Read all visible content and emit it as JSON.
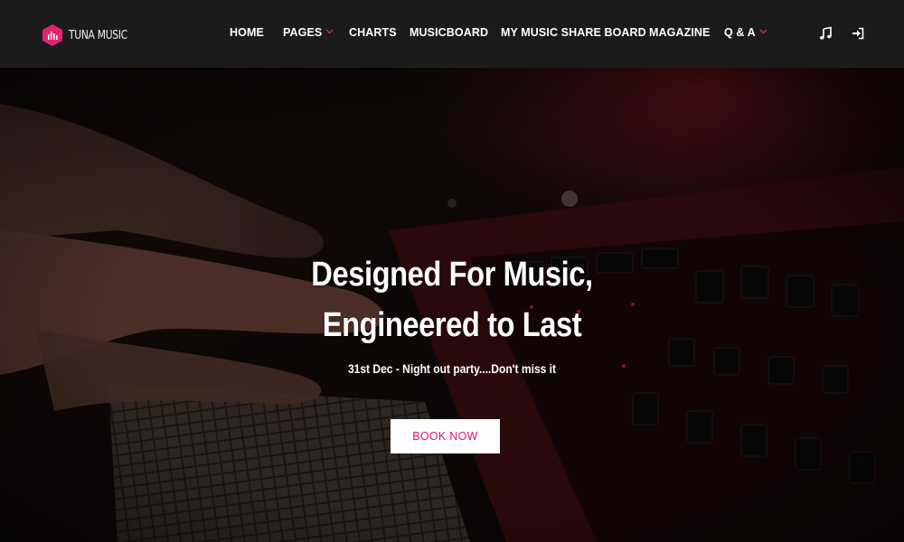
{
  "brand": {
    "name": "TUNA MUSIC",
    "accent": "#e5226f"
  },
  "nav": {
    "items": [
      {
        "label": "HOME",
        "dropdown": false
      },
      {
        "label": "PAGES",
        "dropdown": true
      },
      {
        "label": "CHARTS",
        "dropdown": false
      },
      {
        "label": "MUSICBOARD",
        "dropdown": false
      },
      {
        "label": "MY MUSIC SHARE BOARD",
        "dropdown": false
      },
      {
        "label": "MAGAZINE",
        "dropdown": false
      },
      {
        "label": "Q & A",
        "dropdown": true
      }
    ],
    "icons": [
      "music-note-icon",
      "sign-in-icon"
    ]
  },
  "hero": {
    "title_line1": "Designed For Music,",
    "title_line2": "Engineered to Last",
    "subtitle": "31st Dec - Night out party....Don't miss it",
    "button_label": "BOOK NOW",
    "button_text_color": "#e3106f"
  }
}
